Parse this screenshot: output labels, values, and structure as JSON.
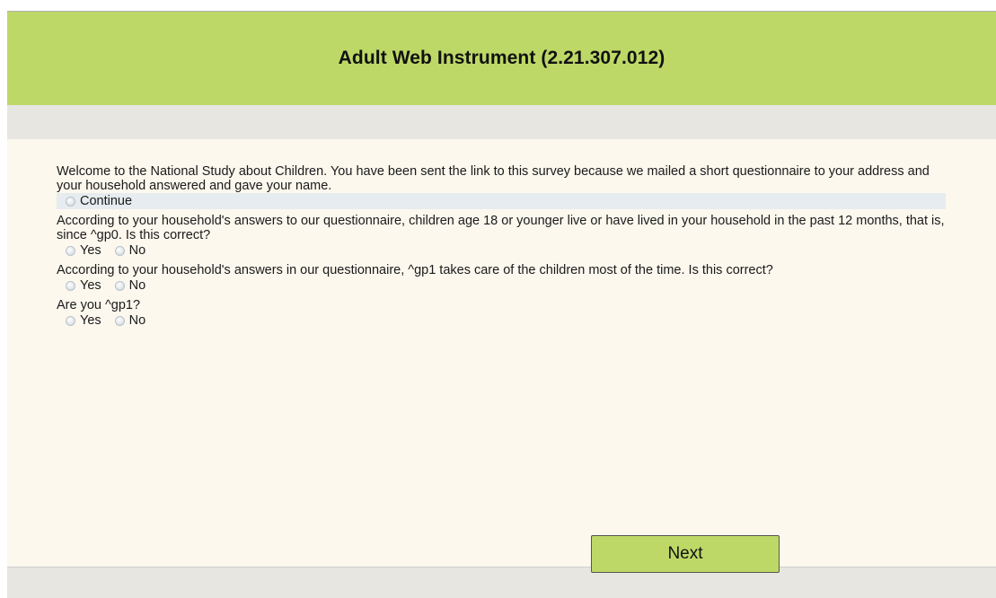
{
  "header": {
    "title": "Adult Web Instrument (2.21.307.012)"
  },
  "questions": [
    {
      "text": "Welcome to the National Study about Children. You have been sent the link to this survey because we mailed a short questionnaire to your address and your household answered and gave your name.",
      "options": [
        "Continue"
      ]
    },
    {
      "text": "According to your household's answers to our questionnaire, children age 18 or younger live or have lived in your household in the past 12 months, that is, since ^gp0. Is this correct?",
      "options": [
        "Yes",
        "No"
      ]
    },
    {
      "text": "According to your household's answers in our questionnaire, ^gp1 takes care of the children most of the time. Is this correct?",
      "options": [
        "Yes",
        "No"
      ]
    },
    {
      "text": "Are you ^gp1?",
      "options": [
        "Yes",
        "No"
      ]
    }
  ],
  "footer": {
    "next_label": "Next"
  },
  "colors": {
    "header_bg": "#bdd866",
    "page_bg": "#fcf8ee",
    "bar_bg": "#e7e6e1",
    "highlight_bg": "#e6ecef"
  }
}
